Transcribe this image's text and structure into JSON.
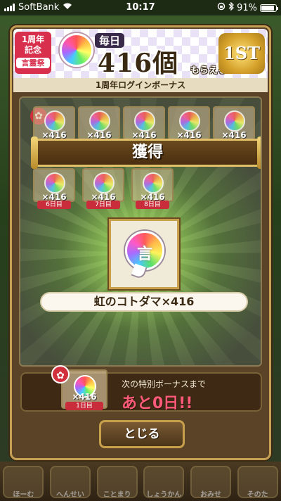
{
  "status_bar": {
    "carrier": "SoftBank",
    "time": "10:17",
    "battery_pct": "91%",
    "battery_level": 0.91
  },
  "banner": {
    "badge_top": "1周年",
    "badge_mid": "記念",
    "badge_bottom": "言霊祭",
    "daily": "毎日",
    "count": "416個",
    "morael": "もらえる!",
    "first": "1ST",
    "orb_glyph": "言"
  },
  "dialog": {
    "subtitle": "1周年ログインボーナス",
    "acquired": "獲得",
    "reward_label": "虹のコトダマ×416",
    "close": "とじる",
    "paw_icon": "paw-icon"
  },
  "calendar": {
    "row1": [
      {
        "count": "×416"
      },
      {
        "count": "×416"
      },
      {
        "count": "×416"
      },
      {
        "count": "×416"
      },
      {
        "count": "×416"
      }
    ],
    "row2": [
      {
        "count": "×416",
        "day": "6日目"
      },
      {
        "count": "×416",
        "day": "7日目"
      },
      {
        "count": "×416",
        "day": "8日目"
      }
    ]
  },
  "special_bonus": {
    "title": "次の特別ボーナスまで",
    "remaining": "あと0日!!",
    "item_count": "×416",
    "item_day": "1日目"
  },
  "bottom_nav": [
    {
      "label": "ほーむ"
    },
    {
      "label": "へんせい"
    },
    {
      "label": "ことまり"
    },
    {
      "label": "しょうかん"
    },
    {
      "label": "おみせ"
    },
    {
      "label": "そのた"
    }
  ]
}
